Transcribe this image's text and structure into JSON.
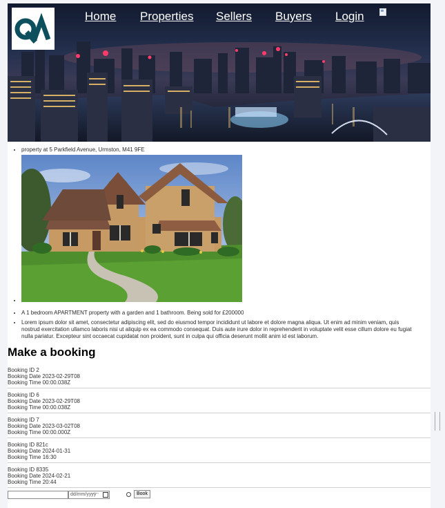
{
  "header": {
    "logo_text": "QA",
    "nav": [
      {
        "label": "Home"
      },
      {
        "label": "Properties"
      },
      {
        "label": "Sellers"
      },
      {
        "label": "Buyers"
      },
      {
        "label": "Login"
      }
    ]
  },
  "property": {
    "address": "property at 5 Parkfield Avenue, Urmston, M41 9FE",
    "description": "A 1 bedroom APARTMENT property with a garden and 1 bathroom. Being sold for £200000",
    "lorem": "Lorem ipsum dolor sit amet, consectetur adipiscing elit, sed do eiusmod tempor incididunt ut labore et dolore magna aliqua. Ut enim ad minim veniam, quis nostrud exercitation ullamco laboris nisi ut aliquip ex ea commodo consequat. Duis aute irure dolor in reprehenderit in voluptate velit esse cillum dolore eu fugiat nulla pariatur. Excepteur sint occaecat cupidatat non proident, sunt in culpa qui officia deserunt mollit anim id est laborum."
  },
  "booking_section": {
    "title": "Make a booking",
    "bookings": [
      {
        "id": "Booking ID 2",
        "date": "Booking Date 2023-02-29T08",
        "time": "Booking Time 00:00.038Z"
      },
      {
        "id": "Booking ID 6",
        "date": "Booking Date 2023-02-29T08",
        "time": "Booking Time 00:00.038Z"
      },
      {
        "id": "Booking ID 7",
        "date": "Booking Date 2023-03-02T08",
        "time": "Booking Time 00:00.000Z"
      },
      {
        "id": "Booking ID 821c",
        "date": "Booking Date 2024-01-31",
        "time": "Booking Time 16:30"
      },
      {
        "id": "Booking ID 8335",
        "date": "Booking Date 2024-02-21",
        "time": "Booking Time 20:44"
      }
    ],
    "form": {
      "text_value": "",
      "date_placeholder": "dd/mm/yyyy",
      "time_placeholder": "--:--",
      "book_label": "Book"
    }
  },
  "colors": {
    "logo_teal": "#0d4f5c",
    "nav_text": "#ffffff",
    "page_bg": "#f3f4f8"
  }
}
